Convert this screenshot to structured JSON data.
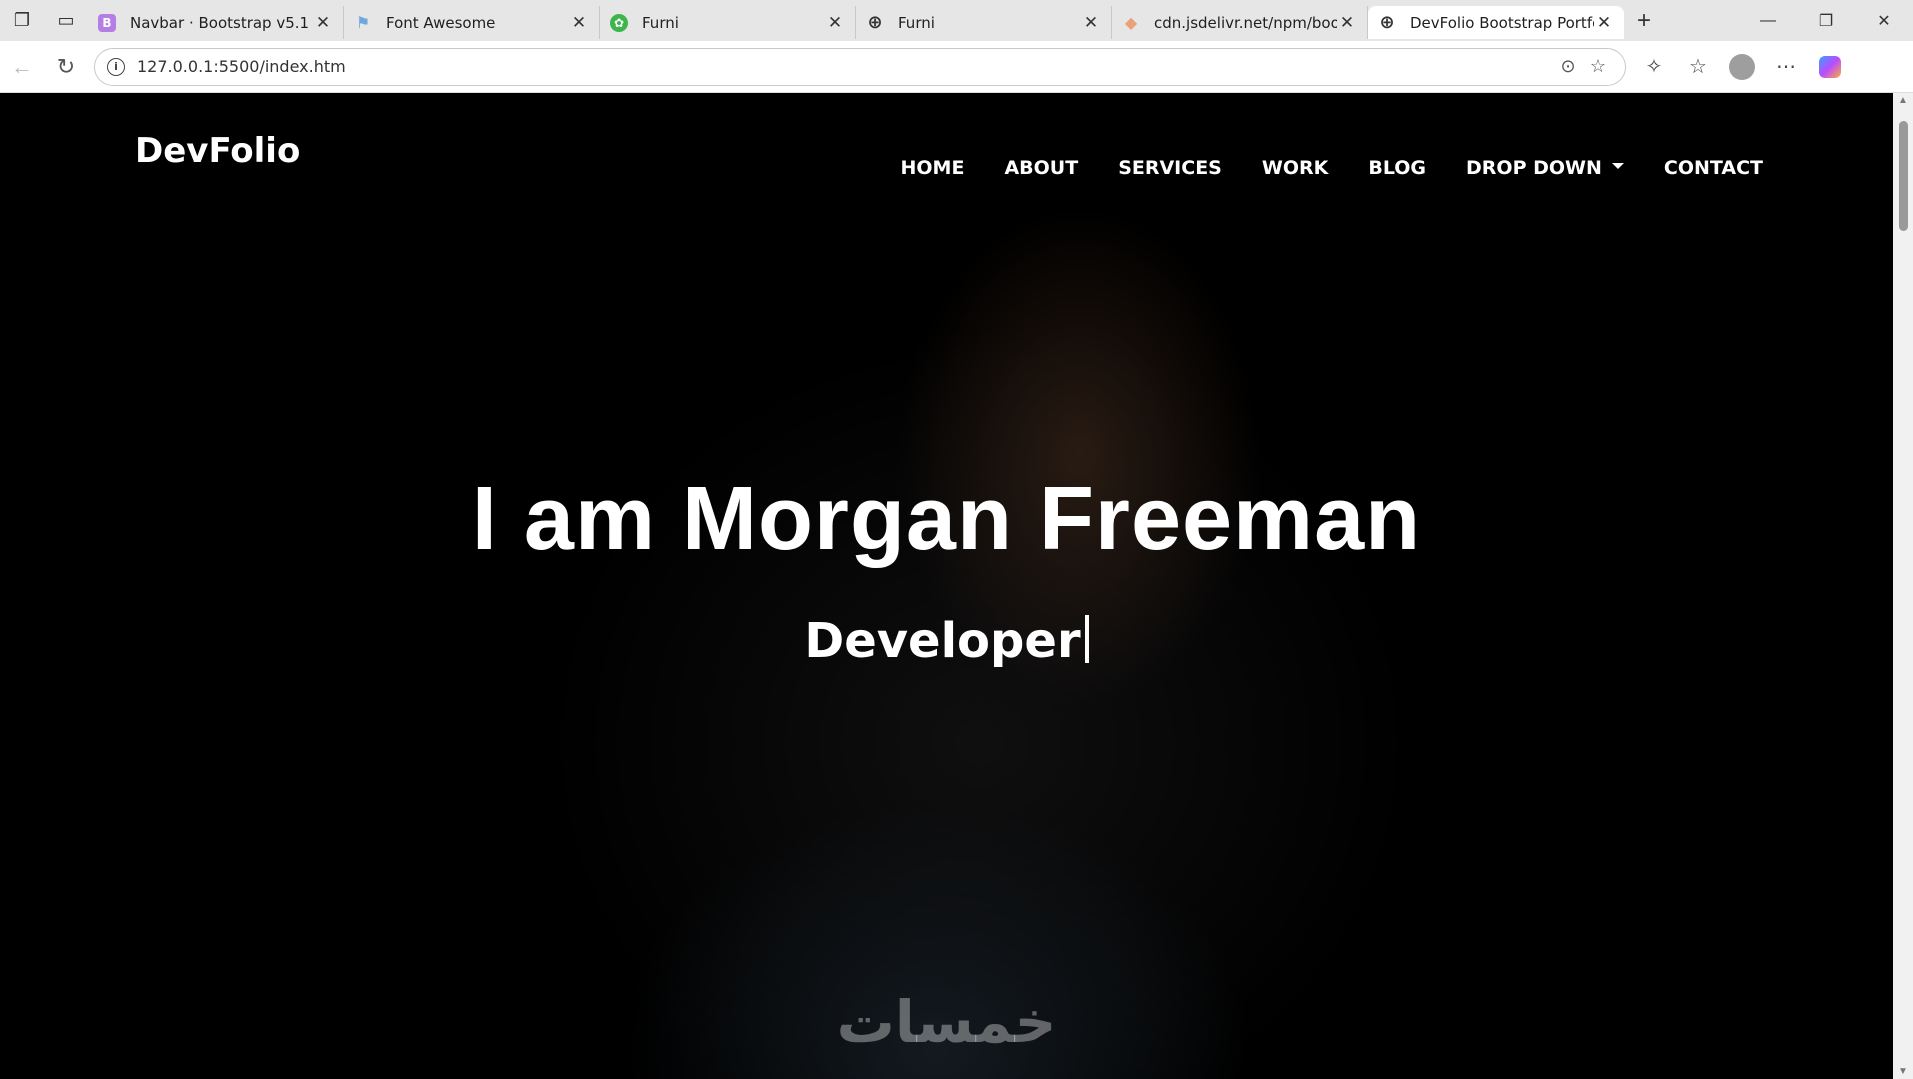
{
  "browser": {
    "tabs": [
      {
        "title": "Navbar · Bootstrap v5.1",
        "favicon_color": "#b57ee5",
        "favicon_glyph": "B"
      },
      {
        "title": "Font Awesome",
        "favicon_color": "#6fa8dc",
        "favicon_glyph": "⚑"
      },
      {
        "title": "Furni",
        "favicon_color": "#3cb54a",
        "favicon_glyph": "✿"
      },
      {
        "title": "Furni",
        "favicon_color": "#ffffff",
        "favicon_glyph": "⊕"
      },
      {
        "title": "cdn.jsdelivr.net/npm/boots",
        "favicon_color": "#e8a27a",
        "favicon_glyph": "◆"
      },
      {
        "title": "DevFolio Bootstrap Portfoli",
        "favicon_color": "#ffffff",
        "favicon_glyph": "⊕"
      }
    ],
    "active_tab_index": 5,
    "address_url": "127.0.0.1:5500/index.htm"
  },
  "page": {
    "brand": "DevFolio",
    "nav_items": [
      "HOME",
      "ABOUT",
      "SERVICES",
      "WORK",
      "BLOG",
      "DROP DOWN",
      "CONTACT"
    ],
    "hero_title": "I am Morgan Freeman",
    "hero_subtitle": "Developer",
    "watermark": "خمسات"
  },
  "colors": {
    "navbar_bg": "#000000",
    "hero_text": "#ffffff",
    "tabstrip_bg": "#e6e6e6"
  }
}
